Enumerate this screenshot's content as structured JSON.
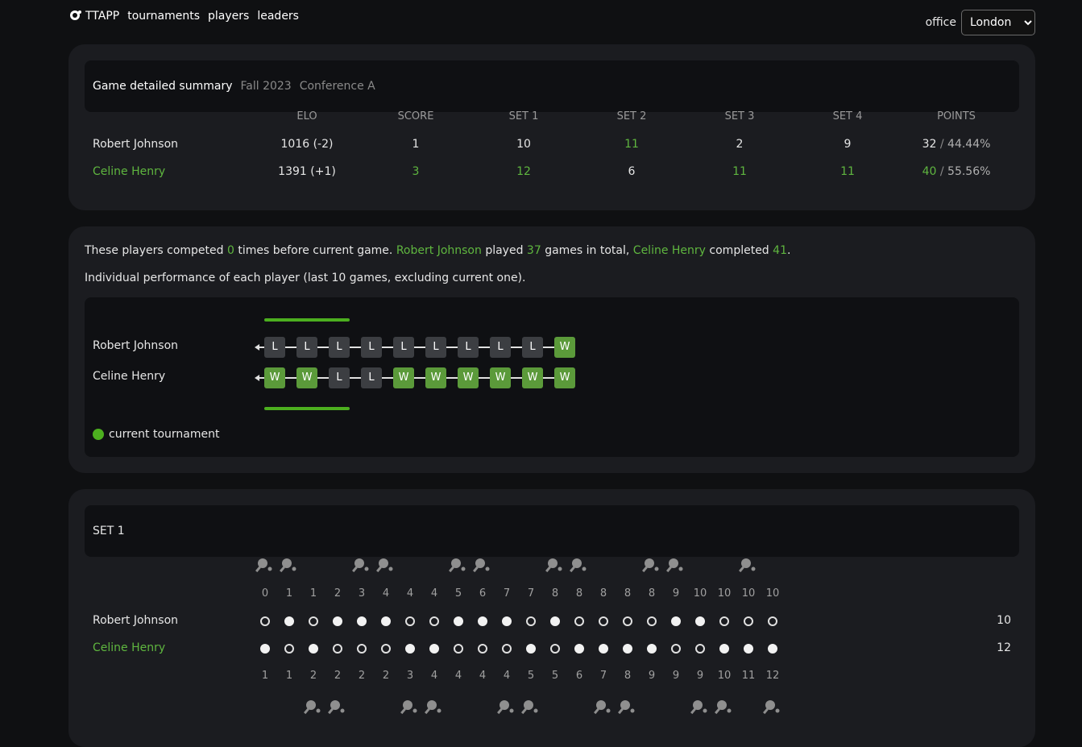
{
  "nav": {
    "brand": "TTAPP",
    "links": [
      "tournaments",
      "players",
      "leaders"
    ]
  },
  "office": {
    "label": "office",
    "selected": "London"
  },
  "summary": {
    "title": "Game detailed summary",
    "season": "Fall 2023",
    "conference": "Conference A",
    "columns": [
      "ELO",
      "SCORE",
      "SET 1",
      "SET 2",
      "SET 3",
      "SET 4",
      "POINTS"
    ],
    "players": [
      {
        "name": "Robert Johnson",
        "winner": false,
        "elo": "1016 (-2)",
        "score": "1",
        "sets": [
          {
            "v": "10",
            "won": false
          },
          {
            "v": "11",
            "won": true
          },
          {
            "v": "2",
            "won": false
          },
          {
            "v": "9",
            "won": false
          }
        ],
        "points": "32",
        "percent": "44.44%"
      },
      {
        "name": "Celine Henry",
        "winner": true,
        "elo": "1391 (+1)",
        "score": "3",
        "sets": [
          {
            "v": "12",
            "won": true
          },
          {
            "v": "6",
            "won": false
          },
          {
            "v": "11",
            "won": true
          },
          {
            "v": "11",
            "won": true
          }
        ],
        "points": "40",
        "percent": "55.56%"
      }
    ]
  },
  "history": {
    "s1": "These players competed ",
    "met": "0",
    "s2": " times before current game. ",
    "p1": "Robert Johnson",
    "s3": " played ",
    "p1_games": "37",
    "s4": " games in total, ",
    "p2": "Celine Henry",
    "s5": " completed ",
    "p2_games": "41",
    "s6": ".",
    "subtitle": "Individual performance of each player (last 10 games, excluding current one).",
    "legend": "current tournament",
    "players": [
      {
        "name": "Robert Johnson",
        "results": [
          "L",
          "L",
          "L",
          "L",
          "L",
          "L",
          "L",
          "L",
          "L",
          "W"
        ]
      },
      {
        "name": "Celine Henry",
        "results": [
          "W",
          "W",
          "L",
          "L",
          "W",
          "W",
          "W",
          "W",
          "W",
          "W"
        ]
      }
    ],
    "current_tournament_games": 3
  },
  "set1": {
    "title": "SET 1",
    "top_numbers": [
      "0",
      "1",
      "1",
      "2",
      "3",
      "4",
      "4",
      "4",
      "5",
      "6",
      "7",
      "7",
      "8",
      "8",
      "8",
      "8",
      "8",
      "9",
      "10",
      "10",
      "10",
      "10"
    ],
    "bottom_numbers": [
      "1",
      "1",
      "2",
      "2",
      "2",
      "2",
      "3",
      "4",
      "4",
      "4",
      "4",
      "5",
      "5",
      "6",
      "7",
      "8",
      "9",
      "9",
      "9",
      "10",
      "11",
      "12"
    ],
    "p1_name": "Robert Johnson",
    "p2_name": "Celine Henry",
    "p1_total": "10",
    "p2_total": "12",
    "p1_points": [
      0,
      1,
      0,
      1,
      1,
      1,
      0,
      0,
      1,
      1,
      1,
      0,
      1,
      0,
      0,
      0,
      0,
      1,
      1,
      0,
      0,
      0
    ],
    "p2_points": [
      1,
      0,
      1,
      0,
      0,
      0,
      1,
      1,
      0,
      0,
      0,
      1,
      0,
      1,
      1,
      1,
      1,
      0,
      0,
      1,
      1,
      1
    ],
    "top_serve": [
      1,
      1,
      0,
      0,
      1,
      1,
      0,
      0,
      1,
      1,
      0,
      0,
      1,
      1,
      0,
      0,
      1,
      1,
      0,
      0,
      1,
      0
    ],
    "bottom_serve": [
      0,
      0,
      1,
      1,
      0,
      0,
      1,
      1,
      0,
      0,
      1,
      1,
      0,
      0,
      1,
      1,
      0,
      0,
      1,
      1,
      0,
      1
    ]
  },
  "colors": {
    "green": "#5fb63f",
    "win_badge": "#5b9a3a",
    "loss_badge": "#3c3e42",
    "tournament_bar": "#4caf1f"
  }
}
